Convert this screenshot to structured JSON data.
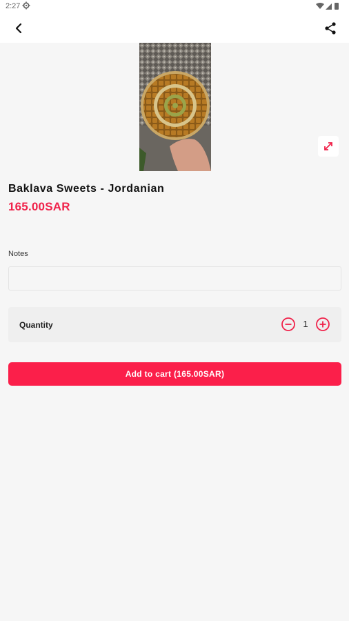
{
  "status_bar": {
    "time": "2:27"
  },
  "product": {
    "title": "Baklava Sweets - Jordanian",
    "price": "165.00SAR"
  },
  "notes": {
    "label": "Notes",
    "value": "",
    "placeholder": ""
  },
  "quantity": {
    "label": "Quantity",
    "value": "1"
  },
  "cart_button": {
    "label": "Add to cart (165.00SAR)"
  },
  "icons": {
    "back": "arrow-back-icon",
    "share": "share-icon",
    "expand": "expand-icon",
    "minus": "minus-circle-icon",
    "plus": "plus-circle-icon",
    "settings": "gear-icon",
    "wifi": "wifi-icon",
    "signal": "signal-icon",
    "battery": "battery-icon"
  },
  "colors": {
    "accent": "#fb1f4a",
    "price": "#f0224a",
    "background": "#f6f6f6",
    "card": "#efefef"
  }
}
